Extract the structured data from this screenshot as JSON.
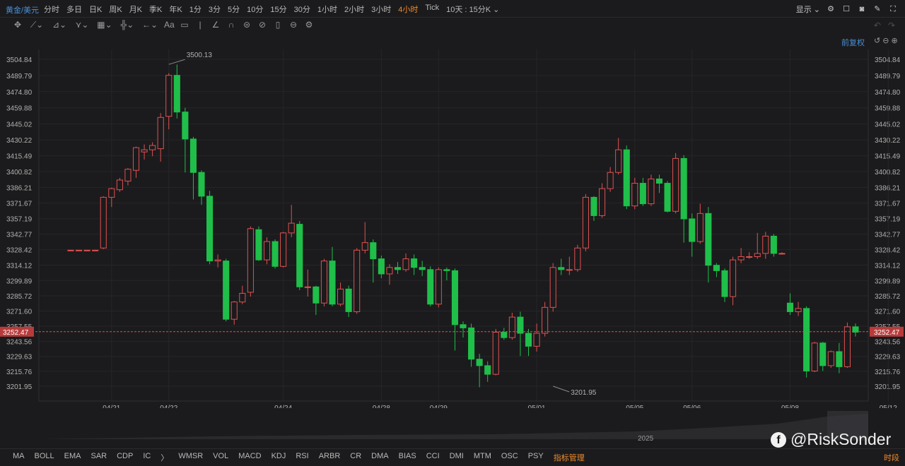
{
  "topbar": {
    "symbol": "黄金/美元",
    "periods": [
      "分时",
      "多日",
      "日K",
      "周K",
      "月K",
      "季K",
      "年K",
      "1分",
      "3分",
      "5分",
      "10分",
      "15分",
      "30分",
      "1小时",
      "2小时",
      "3小时",
      "4小时",
      "Tick",
      "10天 : 15分K ⌄"
    ],
    "active_period": "4小时",
    "display_label": "显示 ⌄"
  },
  "toolbar": {
    "adjust_label": "前复权"
  },
  "indicators": {
    "items": [
      "MA",
      "BOLL",
      "EMA",
      "SAR",
      "CDP",
      "IC",
      "〉",
      "WMSR",
      "VOL",
      "MACD",
      "KDJ",
      "RSI",
      "ARBR",
      "CR",
      "DMA",
      "BIAS",
      "CCI",
      "DMI",
      "MTM",
      "OSC",
      "PSY"
    ],
    "manager": "指标管理",
    "time_segment": "时段"
  },
  "navigator": {
    "year": "2025"
  },
  "watermark": {
    "text": "@RiskSonder"
  },
  "colors": {
    "up": "#e05050",
    "down": "#1fbf4a",
    "current": "#e05050"
  },
  "chart_data": {
    "type": "candlestick",
    "y_ticks": [
      3504.84,
      3489.79,
      3474.8,
      3459.88,
      3445.02,
      3430.22,
      3415.49,
      3400.82,
      3386.21,
      3371.67,
      3357.19,
      3342.77,
      3328.42,
      3314.12,
      3299.89,
      3285.72,
      3271.6,
      3257.55,
      3243.56,
      3229.63,
      3215.76,
      3201.95
    ],
    "ylim": [
      3194,
      3512
    ],
    "x_labels": [
      "04/21",
      "04/22",
      "04/24",
      "04/28",
      "04/29",
      "05/01",
      "05/05",
      "05/06",
      "05/08",
      "05/12",
      "05/13"
    ],
    "x_label_index": [
      5,
      12,
      26,
      38,
      45,
      57,
      69,
      76,
      88,
      100,
      107
    ],
    "current_price": 3252.47,
    "current_label": "3252.47",
    "annotations": [
      {
        "label": "3500.13",
        "index": 12,
        "value": 3500.13
      },
      {
        "label": "3201.95",
        "index": 59,
        "value": 3201.95
      }
    ],
    "candles": [
      [
        3328,
        3328,
        3328,
        3328
      ],
      [
        3328,
        3328,
        3328,
        3328
      ],
      [
        3328,
        3328,
        3328,
        3328
      ],
      [
        3328,
        3328,
        3328,
        3328
      ],
      [
        3330,
        3377,
        3378,
        3329
      ],
      [
        3377,
        3385,
        3386,
        3368
      ],
      [
        3384,
        3393,
        3395,
        3382
      ],
      [
        3392,
        3403,
        3404,
        3388
      ],
      [
        3402,
        3423,
        3424,
        3395
      ],
      [
        3419,
        3421,
        3426,
        3412
      ],
      [
        3421,
        3425,
        3428,
        3415
      ],
      [
        3422,
        3451,
        3455,
        3410
      ],
      [
        3452,
        3490,
        3492,
        3440
      ],
      [
        3490,
        3456,
        3500,
        3450
      ],
      [
        3456,
        3431,
        3460,
        3400
      ],
      [
        3431,
        3400,
        3433,
        3375
      ],
      [
        3400,
        3378,
        3402,
        3370
      ],
      [
        3378,
        3318,
        3383,
        3315
      ],
      [
        3318,
        3319,
        3324,
        3312
      ],
      [
        3318,
        3264,
        3320,
        3262
      ],
      [
        3264,
        3280,
        3281,
        3259
      ],
      [
        3280,
        3288,
        3295,
        3278
      ],
      [
        3289,
        3348,
        3350,
        3285
      ],
      [
        3347,
        3319,
        3350,
        3318
      ],
      [
        3319,
        3336,
        3340,
        3315
      ],
      [
        3336,
        3313,
        3338,
        3311
      ],
      [
        3313,
        3344,
        3345,
        3312
      ],
      [
        3344,
        3353,
        3370,
        3340
      ],
      [
        3352,
        3294,
        3355,
        3291
      ],
      [
        3294,
        3294,
        3310,
        3285
      ],
      [
        3294,
        3279,
        3295,
        3268
      ],
      [
        3279,
        3318,
        3320,
        3276
      ],
      [
        3318,
        3278,
        3331,
        3276
      ],
      [
        3278,
        3292,
        3298,
        3276
      ],
      [
        3292,
        3271,
        3295,
        3266
      ],
      [
        3271,
        3328,
        3330,
        3269
      ],
      [
        3328,
        3335,
        3354,
        3325
      ],
      [
        3335,
        3320,
        3338,
        3298
      ],
      [
        3320,
        3306,
        3323,
        3302
      ],
      [
        3306,
        3312,
        3315,
        3296
      ],
      [
        3312,
        3310,
        3317,
        3306
      ],
      [
        3310,
        3320,
        3325,
        3308
      ],
      [
        3320,
        3312,
        3324,
        3305
      ],
      [
        3312,
        3310,
        3318,
        3304
      ],
      [
        3310,
        3278,
        3313,
        3276
      ],
      [
        3278,
        3310,
        3312,
        3275
      ],
      [
        3310,
        3309,
        3312,
        3300
      ],
      [
        3309,
        3259,
        3311,
        3235
      ],
      [
        3259,
        3256,
        3262,
        3247
      ],
      [
        3256,
        3227,
        3260,
        3220
      ],
      [
        3227,
        3221,
        3232,
        3201
      ],
      [
        3221,
        3213,
        3225,
        3206
      ],
      [
        3213,
        3252,
        3255,
        3212
      ],
      [
        3252,
        3247,
        3256,
        3245
      ],
      [
        3247,
        3266,
        3270,
        3245
      ],
      [
        3266,
        3251,
        3271,
        3230
      ],
      [
        3251,
        3239,
        3255,
        3230
      ],
      [
        3239,
        3251,
        3260,
        3234
      ],
      [
        3251,
        3275,
        3280,
        3248
      ],
      [
        3275,
        3312,
        3316,
        3271
      ],
      [
        3312,
        3310,
        3320,
        3305
      ],
      [
        3310,
        3310,
        3322,
        3305
      ],
      [
        3310,
        3330,
        3333,
        3308
      ],
      [
        3330,
        3377,
        3380,
        3327
      ],
      [
        3377,
        3360,
        3378,
        3355
      ],
      [
        3360,
        3385,
        3390,
        3358
      ],
      [
        3385,
        3400,
        3405,
        3382
      ],
      [
        3400,
        3421,
        3432,
        3398
      ],
      [
        3421,
        3369,
        3425,
        3366
      ],
      [
        3369,
        3390,
        3395,
        3366
      ],
      [
        3390,
        3371,
        3395,
        3369
      ],
      [
        3371,
        3394,
        3398,
        3369
      ],
      [
        3394,
        3390,
        3398,
        3381
      ],
      [
        3390,
        3364,
        3392,
        3363
      ],
      [
        3364,
        3413,
        3418,
        3362
      ],
      [
        3413,
        3357,
        3416,
        3335
      ],
      [
        3357,
        3336,
        3362,
        3322
      ],
      [
        3336,
        3362,
        3371,
        3334
      ],
      [
        3362,
        3314,
        3368,
        3298
      ],
      [
        3314,
        3309,
        3316,
        3303
      ],
      [
        3309,
        3285,
        3311,
        3280
      ],
      [
        3285,
        3319,
        3322,
        3277
      ],
      [
        3319,
        3322,
        3330,
        3316
      ],
      [
        3322,
        3322,
        3326,
        3320
      ],
      [
        3322,
        3325,
        3344,
        3320
      ],
      [
        3325,
        3341,
        3345,
        3320
      ],
      [
        3341,
        3325,
        3343,
        3322
      ],
      [
        3325,
        3325,
        3326,
        3324
      ],
      [
        3279,
        3271,
        3288,
        3268
      ],
      [
        3271,
        3274,
        3280,
        3267
      ],
      [
        3274,
        3216,
        3276,
        3210
      ],
      [
        3216,
        3242,
        3243,
        3215
      ],
      [
        3242,
        3221,
        3243,
        3216
      ],
      [
        3221,
        3234,
        3235,
        3219
      ],
      [
        3234,
        3220,
        3242,
        3214
      ],
      [
        3220,
        3257,
        3261,
        3219
      ],
      [
        3257,
        3252,
        3260,
        3248
      ]
    ]
  }
}
